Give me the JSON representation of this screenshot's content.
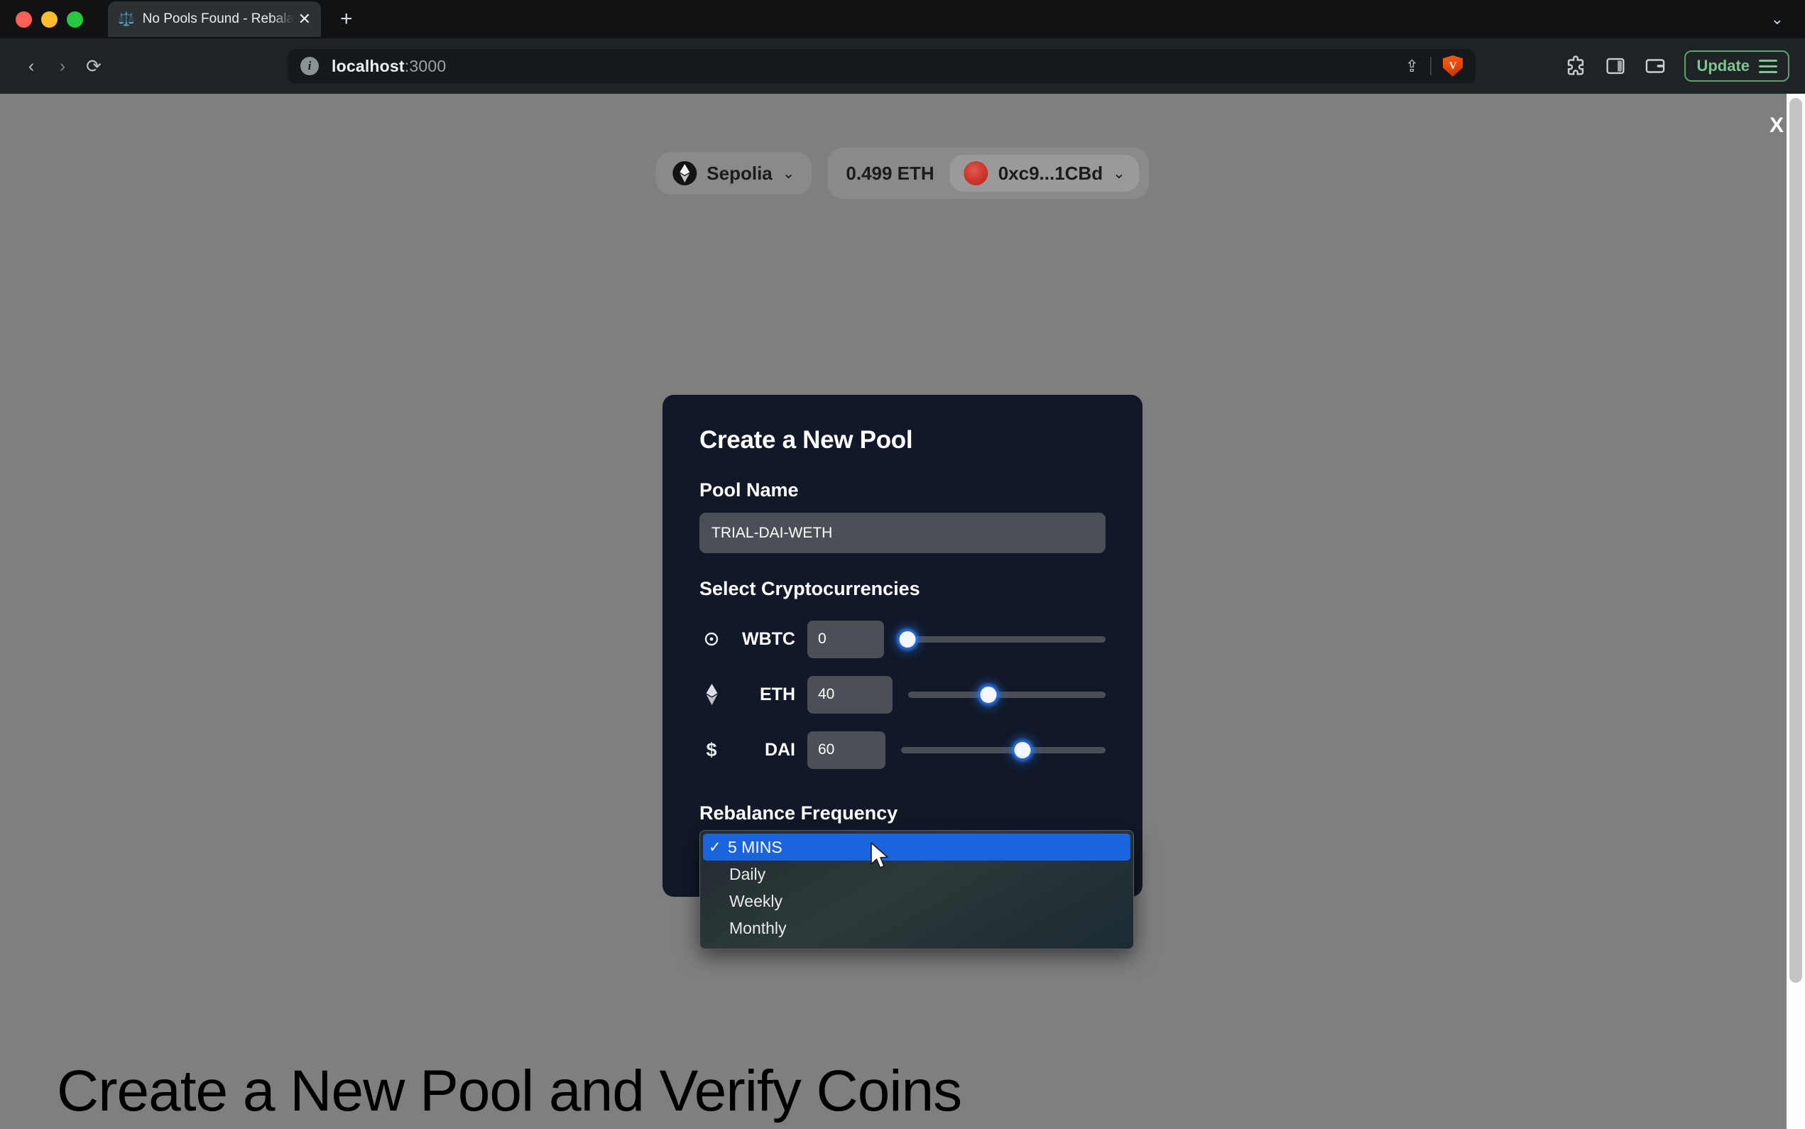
{
  "browser": {
    "tab": {
      "title": "No Pools Found - Rebalancoo",
      "favicon": "⚖️",
      "close_label": "✕"
    },
    "new_tab_label": "+",
    "expand_label": "⌄",
    "nav": {
      "back_label": "‹",
      "forward_label": "›",
      "reload_label": "⟳"
    },
    "omnibox": {
      "url_host": "localhost",
      "url_port": ":3000",
      "info_label": "i",
      "share_label": "⇪",
      "brave_label": "V"
    },
    "update_button_label": "Update"
  },
  "page": {
    "close_overlay_label": "X",
    "heading": "Create a New Pool and Verify Coins"
  },
  "wallet": {
    "network_name": "Sepolia",
    "network_chevron": "⌄",
    "eth_balance": "0.499 ETH",
    "address": "0xc9...1CBd",
    "account_chevron": "⌄"
  },
  "modal": {
    "title": "Create a New Pool",
    "pool_name_label": "Pool Name",
    "pool_name_value": "TRIAL-DAI-WETH",
    "pool_name_placeholder": "Pool Name",
    "select_crypto_label": "Select Cryptocurrencies",
    "coins": [
      {
        "symbol": "WBTC",
        "icon": "bitcoin-icon",
        "amount": "0",
        "slider_percent": 0
      },
      {
        "symbol": "ETH",
        "icon": "ethereum-icon",
        "amount": "40",
        "slider_percent": 40
      },
      {
        "symbol": "DAI",
        "icon": "dollar-icon",
        "amount": "60",
        "slider_percent": 60
      }
    ],
    "rebalance_label": "Rebalance Frequency",
    "frequency_selected": "5 MINS",
    "frequency_options": [
      {
        "label": "5 MINS",
        "selected": true,
        "check": "✓"
      },
      {
        "label": "Daily",
        "selected": false,
        "check": "✓"
      },
      {
        "label": "Weekly",
        "selected": false,
        "check": "✓"
      },
      {
        "label": "Monthly",
        "selected": false,
        "check": "✓"
      }
    ],
    "select_arrow": "⌃"
  },
  "colors": {
    "modal_bg": "#111827",
    "overlay": "#7f7f7f",
    "accent_blue": "#1a64dd",
    "slider_thumb_glow": "#2a74eb",
    "update_green": "#7fc48e"
  }
}
